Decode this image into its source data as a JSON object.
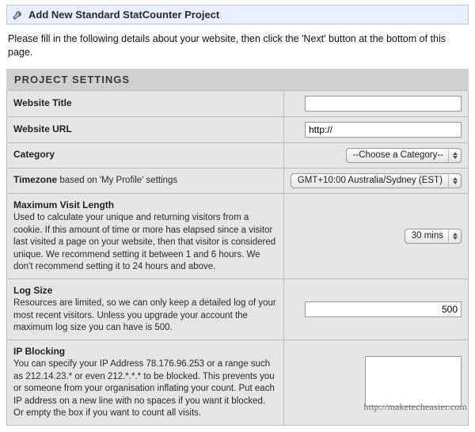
{
  "header": {
    "title": "Add New Standard StatCounter Project"
  },
  "intro": "Please fill in the following details about your website, then click the 'Next' button at the bottom of this page.",
  "section_title": "PROJECT SETTINGS",
  "rows": {
    "website_title": {
      "label": "Website Title",
      "value": ""
    },
    "website_url": {
      "label": "Website URL",
      "value": "http://"
    },
    "category": {
      "label": "Category",
      "selected": "--Choose a Category--"
    },
    "timezone": {
      "label_prefix": "Timezone",
      "label_suffix": " based on 'My Profile' settings",
      "selected": "GMT+10:00 Australia/Sydney (EST)"
    },
    "max_visit": {
      "label": "Maximum Visit Length",
      "desc": "Used to calculate your unique and returning visitors from a cookie. If this amount of time or more has elapsed since a visitor last visited a page on your website, then that visitor is considered unique. We recommend setting it between 1 and 6 hours. We don't recommend setting it to 24 hours and above.",
      "selected": "30 mins"
    },
    "log_size": {
      "label": "Log Size",
      "desc": "Resources are limited, so we can only keep a detailed log of your most recent visitors. Unless you upgrade your account the maximum log size you can have is 500.",
      "value": "500"
    },
    "ip_blocking": {
      "label": "IP Blocking",
      "desc": "You can specify your IP Address 78.176.96.253 or a range such as 212.14.23.* or even 212.*.*.* to be blocked. This prevents you or someone from your organisation inflating your count. Put each IP address on a new line with no spaces if you want it blocked. Or empty the box if you want to count all visits.",
      "value": ""
    }
  },
  "footer_url": "http://maketecheasier.com"
}
